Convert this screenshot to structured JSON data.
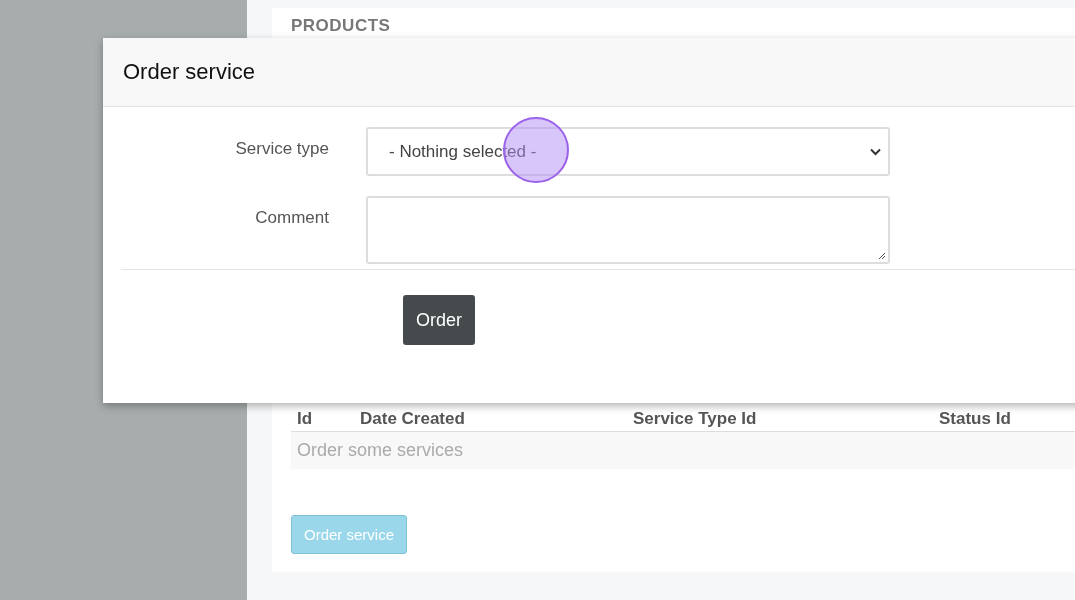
{
  "panel": {
    "title": "PRODUCTS",
    "table": {
      "columns": [
        "Id",
        "Date Created",
        "Service Type Id",
        "Status Id"
      ],
      "empty_message": "Order some services"
    },
    "button": "Order service"
  },
  "dialog": {
    "title": "Order service",
    "fields": [
      {
        "kind": "select",
        "label": "Service type",
        "value": "- Nothing selected -"
      },
      {
        "kind": "textarea",
        "label": "Comment"
      }
    ],
    "submit": "Order"
  }
}
